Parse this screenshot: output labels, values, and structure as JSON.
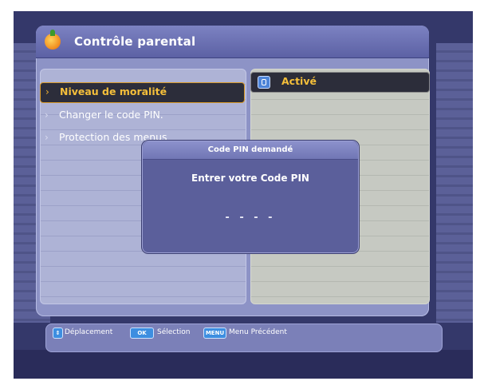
{
  "screen": {
    "title": "Contrôle parental",
    "title_icon": "orange-fruit-icon"
  },
  "menu": {
    "items": [
      {
        "label": "Niveau de moralité",
        "selected": true
      },
      {
        "label": "Changer le code PIN.",
        "selected": false
      },
      {
        "label": "Protection des menus",
        "selected": false
      }
    ]
  },
  "value_panel": {
    "icon": "info-icon",
    "value": "Activé"
  },
  "dialog": {
    "title": "Code PIN demandé",
    "message": "Entrer votre Code PIN",
    "pin_placeholder": "- - - -"
  },
  "help_bar": {
    "move_label": "Déplacement",
    "ok_key": "OK",
    "select_label": "Sélection",
    "menu_key": "MENU",
    "back_label": "Menu Précédent"
  },
  "colors": {
    "background": "#34386a",
    "panel": "#8d93c6",
    "highlight_text": "#f5bf3a",
    "key_blue": "#3d8ee0"
  }
}
